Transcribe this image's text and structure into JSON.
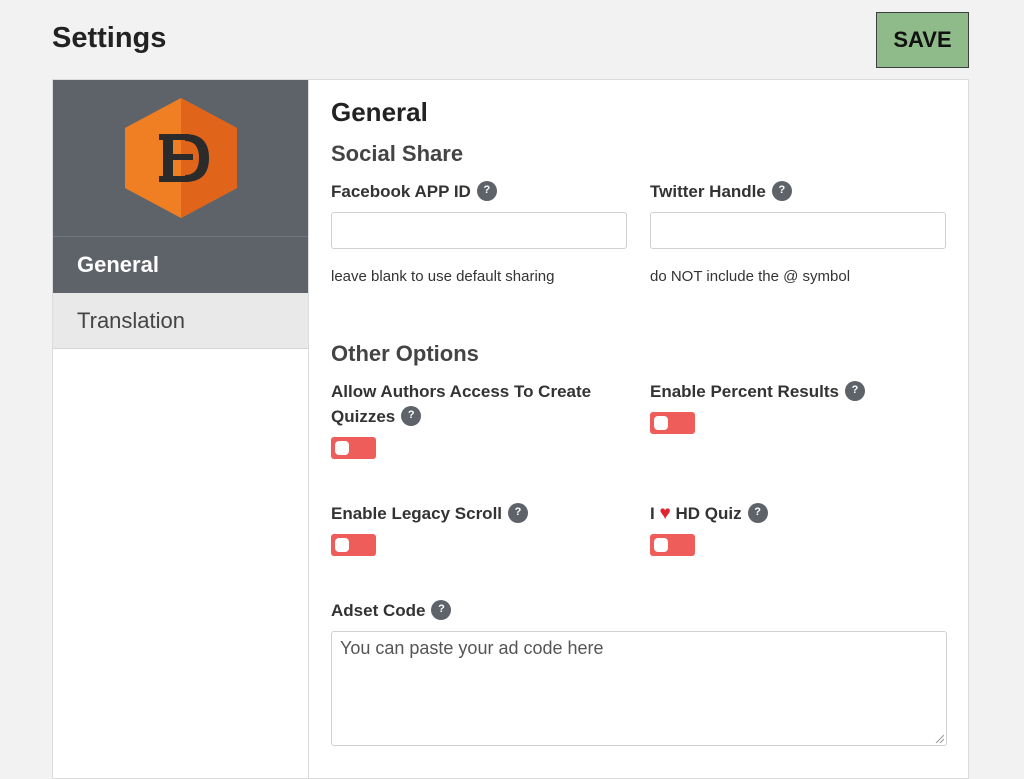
{
  "header": {
    "title": "Settings",
    "save_label": "SAVE"
  },
  "sidebar": {
    "logo_icon": "hd-quiz-logo-icon",
    "items": [
      {
        "label": "General",
        "active": true
      },
      {
        "label": "Translation",
        "active": false
      }
    ]
  },
  "main": {
    "title": "General",
    "social_share": {
      "heading": "Social Share",
      "facebook": {
        "label": "Facebook APP ID",
        "value": "",
        "help": "leave blank to use default sharing"
      },
      "twitter": {
        "label": "Twitter Handle",
        "value": "",
        "help": "do NOT include the @ symbol"
      }
    },
    "other_options": {
      "heading": "Other Options",
      "allow_authors": {
        "label": "Allow Authors Access To Create Quizzes",
        "enabled": false
      },
      "percent_results": {
        "label": "Enable Percent Results",
        "enabled": false
      },
      "legacy_scroll": {
        "label": "Enable Legacy Scroll",
        "enabled": false
      },
      "love_hd_quiz": {
        "label_prefix": "I",
        "label_suffix": "HD Quiz",
        "heart_icon": "heart-icon",
        "enabled": false
      }
    },
    "adset": {
      "label": "Adset Code",
      "placeholder": "You can paste your ad code here",
      "value": ""
    }
  },
  "help_icon_glyph": "?",
  "colors": {
    "save_button": "#8fbb8a",
    "sidebar_active": "#5e636a",
    "toggle_off": "#ef5d5b",
    "heart": "#e0242f",
    "logo_orange": "#f07f23"
  }
}
